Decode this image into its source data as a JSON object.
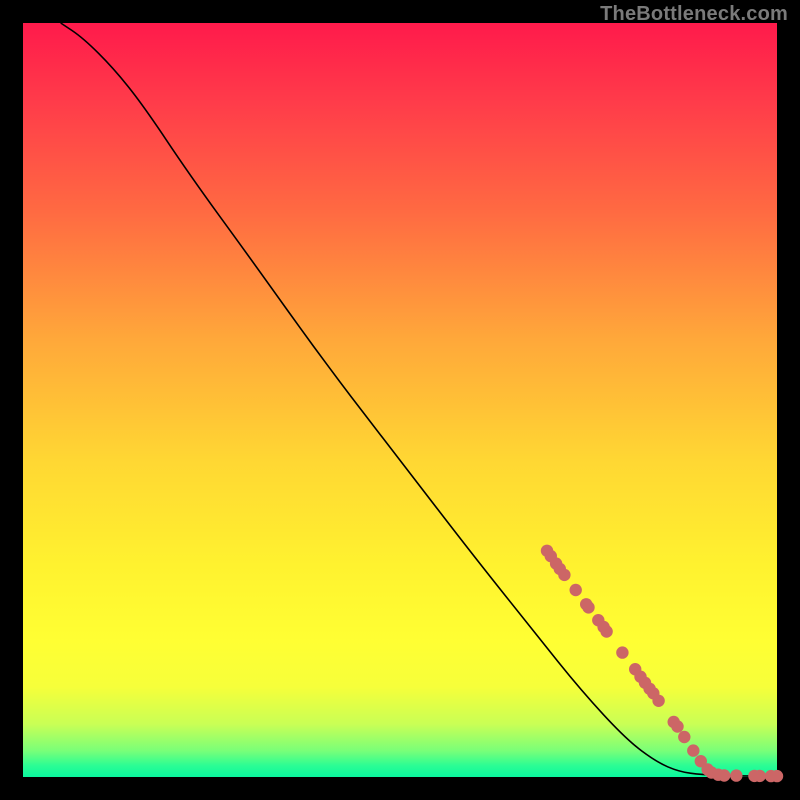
{
  "watermark": "TheBottleneck.com",
  "chart_data": {
    "type": "line",
    "title": "",
    "xlabel": "",
    "ylabel": "",
    "xlim": [
      0,
      100
    ],
    "ylim": [
      0,
      100
    ],
    "curve": [
      [
        5,
        100
      ],
      [
        8,
        98
      ],
      [
        12,
        94
      ],
      [
        16,
        89
      ],
      [
        22,
        80
      ],
      [
        30,
        69
      ],
      [
        40,
        55
      ],
      [
        50,
        42
      ],
      [
        60,
        29
      ],
      [
        68,
        19
      ],
      [
        74,
        11.5
      ],
      [
        80,
        5
      ],
      [
        84,
        2
      ],
      [
        87,
        0.7
      ],
      [
        90,
        0.3
      ],
      [
        94,
        0.15
      ],
      [
        100,
        0.1
      ]
    ],
    "series": [
      {
        "name": "points",
        "data": [
          [
            69.5,
            30.0
          ],
          [
            70.0,
            29.3
          ],
          [
            70.7,
            28.3
          ],
          [
            71.2,
            27.6
          ],
          [
            71.8,
            26.8
          ],
          [
            73.3,
            24.8
          ],
          [
            74.7,
            22.9
          ],
          [
            75.0,
            22.5
          ],
          [
            76.3,
            20.8
          ],
          [
            77.0,
            19.9
          ],
          [
            77.4,
            19.3
          ],
          [
            79.5,
            16.5
          ],
          [
            81.2,
            14.3
          ],
          [
            81.9,
            13.3
          ],
          [
            82.5,
            12.5
          ],
          [
            83.1,
            11.7
          ],
          [
            83.6,
            11.1
          ],
          [
            84.3,
            10.1
          ],
          [
            86.3,
            7.3
          ],
          [
            86.8,
            6.7
          ],
          [
            87.7,
            5.3
          ],
          [
            88.9,
            3.5
          ],
          [
            89.9,
            2.1
          ],
          [
            90.8,
            1.0
          ],
          [
            91.3,
            0.6
          ],
          [
            92.2,
            0.3
          ],
          [
            93.0,
            0.2
          ],
          [
            94.6,
            0.18
          ],
          [
            97.0,
            0.15
          ],
          [
            97.7,
            0.15
          ],
          [
            99.2,
            0.12
          ],
          [
            100.0,
            0.12
          ]
        ]
      }
    ],
    "colors": {
      "curve": "#000000",
      "dots": "#cc6666"
    }
  }
}
